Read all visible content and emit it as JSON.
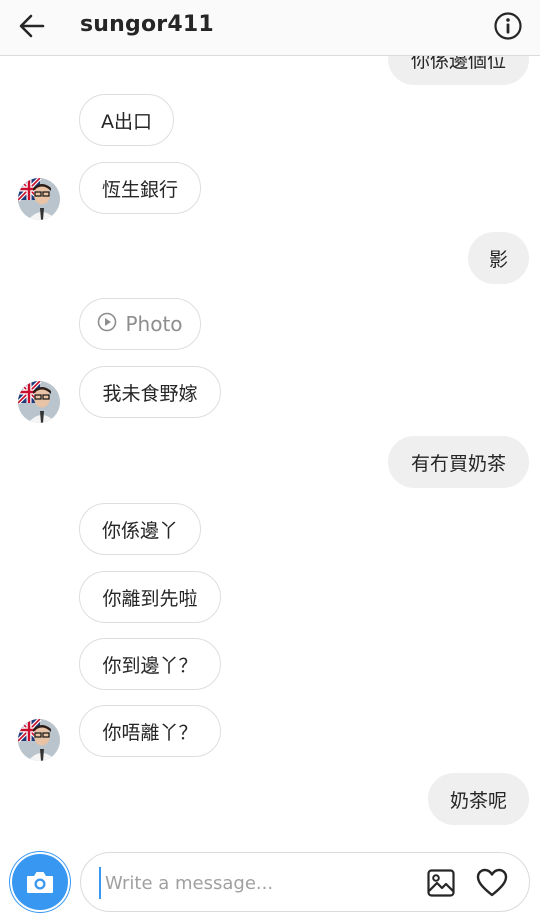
{
  "header": {
    "title": "sungor411",
    "back_icon": "arrow-left-icon",
    "info_icon": "info-icon"
  },
  "messages": [
    {
      "side": "out",
      "text": "你係邊個位"
    },
    {
      "side": "in",
      "text": "A出口"
    },
    {
      "side": "in",
      "text": "恆生銀行"
    },
    {
      "side": "out",
      "text": "影"
    },
    {
      "side": "in",
      "text": "Photo",
      "icon": "play-circle-icon"
    },
    {
      "side": "in",
      "text": "我未食野嫁"
    },
    {
      "side": "out",
      "text": "有冇買奶茶"
    },
    {
      "side": "in",
      "text": "你係邊丫"
    },
    {
      "side": "in",
      "text": "你離到先啦"
    },
    {
      "side": "in",
      "text": "你到邊丫？"
    },
    {
      "side": "in",
      "text": "你唔離丫？"
    },
    {
      "side": "out",
      "text": "奶茶呢"
    }
  ],
  "composer": {
    "placeholder": "Write a message...",
    "camera_icon": "camera-icon",
    "gallery_icon": "image-icon",
    "like_icon": "heart-icon"
  },
  "colors": {
    "accent": "#3897f0",
    "outgoing_bubble": "#efefef",
    "incoming_border": "#dedede"
  }
}
